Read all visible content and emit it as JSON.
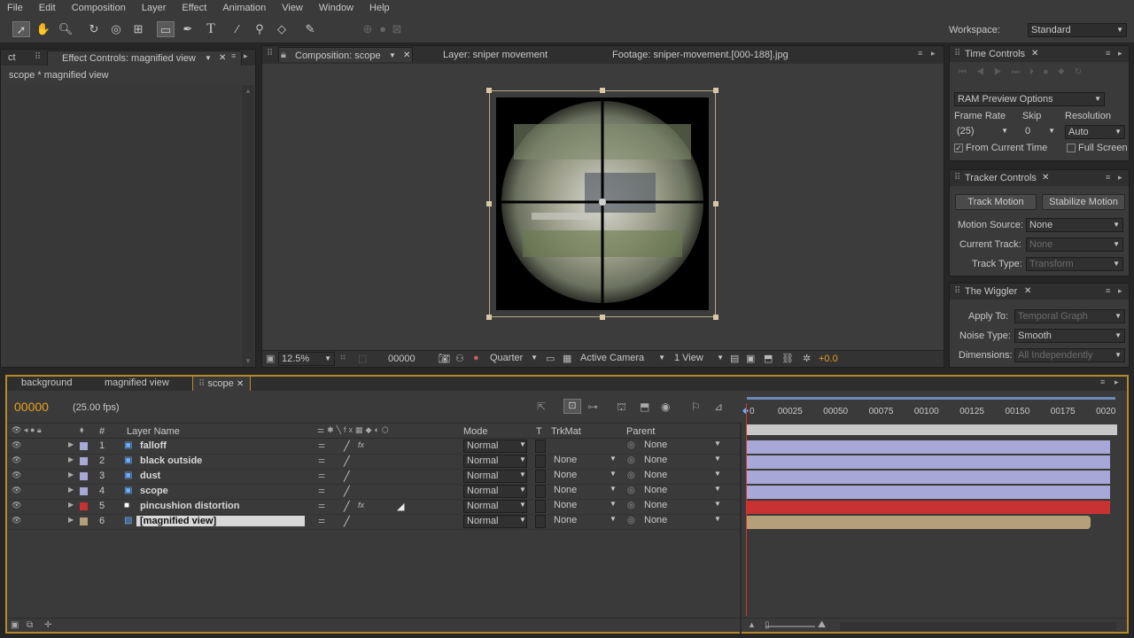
{
  "menu": [
    "File",
    "Edit",
    "Composition",
    "Layer",
    "Effect",
    "Animation",
    "View",
    "Window",
    "Help"
  ],
  "workspace": {
    "label": "Workspace:",
    "value": "Standard"
  },
  "effect_panel": {
    "tab_prefix": "ct",
    "tab_label": "Effect Controls: magnified view",
    "breadcrumb": "scope * magnified view"
  },
  "viewer": {
    "tabs": [
      "Composition: scope",
      "Layer: sniper movement",
      "Footage: sniper-movement.[000-188].jpg"
    ],
    "zoom": "12.5%",
    "timecode": "00000",
    "resolution": "Quarter",
    "camera": "Active Camera",
    "views": "1 View",
    "exposure": "+0.0"
  },
  "time_controls": {
    "title": "Time Controls",
    "ram_preview": "RAM Preview Options",
    "frame_rate_label": "Frame Rate",
    "frame_rate_value": "(25)",
    "skip_label": "Skip",
    "skip_value": "0",
    "resolution_label": "Resolution",
    "resolution_value": "Auto",
    "from_current_time": "From Current Time",
    "full_screen": "Full Screen",
    "from_current_checked": true,
    "full_screen_checked": false
  },
  "tracker": {
    "title": "Tracker Controls",
    "track_motion": "Track Motion",
    "stabilize_motion": "Stabilize Motion",
    "motion_source_label": "Motion Source:",
    "motion_source_value": "None",
    "current_track_label": "Current Track:",
    "current_track_value": "None",
    "track_type_label": "Track Type:",
    "track_type_value": "Transform"
  },
  "wiggler": {
    "title": "The Wiggler",
    "apply_to_label": "Apply To:",
    "apply_to_value": "Temporal Graph",
    "noise_type_label": "Noise Type:",
    "noise_type_value": "Smooth",
    "dimensions_label": "Dimensions:",
    "dimensions_value": "All Independently"
  },
  "timeline": {
    "tabs": [
      "background",
      "magnified view",
      "scope"
    ],
    "timecode": "00000",
    "fps": "(25.00 fps)",
    "headers": {
      "num": "#",
      "layer_name": "Layer Name",
      "mode": "Mode",
      "t": "T",
      "trkmat": "TrkMat",
      "parent": "Parent"
    },
    "ruler": [
      "00025",
      "00050",
      "00075",
      "00100",
      "00125",
      "00150",
      "00175",
      "0020"
    ],
    "ruler_start": "0",
    "layers": [
      {
        "num": "1",
        "name": "falloff",
        "color": "#a8a8d8",
        "mode": "Normal",
        "trkmat": "",
        "parent": "None",
        "fx": true,
        "bar": "#a8a8d8"
      },
      {
        "num": "2",
        "name": "black outside",
        "color": "#a8a8d8",
        "mode": "Normal",
        "trkmat": "None",
        "parent": "None",
        "fx": false,
        "bar": "#a8a8d8"
      },
      {
        "num": "3",
        "name": "dust",
        "color": "#a8a8d8",
        "mode": "Normal",
        "trkmat": "None",
        "parent": "None",
        "fx": false,
        "bar": "#a8a8d8"
      },
      {
        "num": "4",
        "name": "scope",
        "color": "#a8a8d8",
        "mode": "Normal",
        "trkmat": "None",
        "parent": "None",
        "fx": false,
        "bar": "#a8a8d8"
      },
      {
        "num": "5",
        "name": "pincushion distortion",
        "color": "#c83232",
        "mode": "Normal",
        "trkmat": "None",
        "parent": "None",
        "fx": true,
        "bar": "#c83232"
      },
      {
        "num": "6",
        "name": "[magnified view]",
        "color": "#b4a078",
        "mode": "Normal",
        "trkmat": "None",
        "parent": "None",
        "fx": false,
        "bar": "#b4a078"
      }
    ]
  },
  "colors": {
    "accent": "#e8a020",
    "panel": "#3a3a3a",
    "timeline_border": "#b7892a"
  }
}
